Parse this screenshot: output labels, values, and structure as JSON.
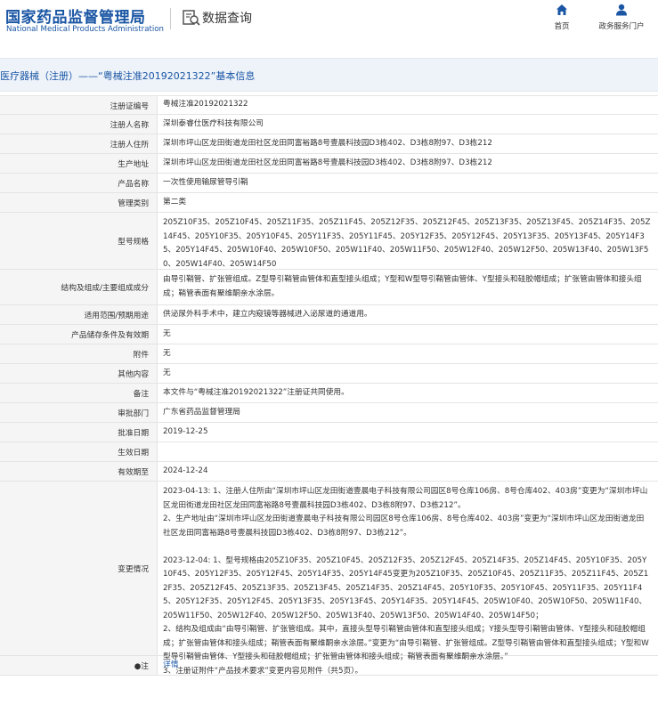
{
  "header": {
    "logo_cn": "国家药品监督管理局",
    "logo_en": "National Medical Products Administration",
    "query_title": "数据查询",
    "nav": [
      {
        "label": "首页",
        "icon": "home-icon"
      },
      {
        "label": "政务服务门户",
        "icon": "user-icon"
      }
    ]
  },
  "banner": {
    "title": "医疗器械（注册）——“粤械注准20192021322”基本信息"
  },
  "rows": [
    {
      "label": "注册证编号",
      "value": "粤械注准20192021322"
    },
    {
      "label": "注册人名称",
      "value": "深圳泰睿仕医疗科技有限公司"
    },
    {
      "label": "注册人住所",
      "value": "深圳市坪山区龙田街道龙田社区龙田同富裕路8号壹晨科技园D3栋402、D3栋8附97、D3栋212"
    },
    {
      "label": "生产地址",
      "value": "深圳市坪山区龙田街道龙田社区龙田同富裕路8号壹晨科技园D3栋402、D3栋8附97、D3栋212"
    },
    {
      "label": "产品名称",
      "value": "一次性使用输尿管导引鞘"
    },
    {
      "label": "管理类别",
      "value": "第二类"
    },
    {
      "label": "型号规格",
      "value": "205Z10F35、205Z10F45、205Z11F35、205Z11F45、205Z12F35、205Z12F45、205Z13F35、205Z13F45、205Z14F35、205Z14F45、205Y10F35、205Y10F45、205Y11F35、205Y11F45、205Y12F35、205Y12F45、205Y13F35、205Y13F45、205Y14F35、205Y14F45、205W10F40、205W10F50、205W11F40、205W11F50、205W12F40、205W12F50、205W13F40、205W13F50、205W14F40、205W14F50"
    },
    {
      "label": "结构及组成/主要组成成分",
      "value": "由导引鞘管、扩张管组成。Z型导引鞘管由管体和直型接头组成；Y型和W型导引鞘管由管体、Y型接头和硅胶帽组成；扩张管由管体和接头组成；鞘管表面有聚维酮亲水涂层。"
    },
    {
      "label": "适用范围/预期用途",
      "value": "供泌尿外科手术中，建立内窥镜等器械进入泌尿道的通道用。"
    },
    {
      "label": "产品储存条件及有效期",
      "value": "无"
    },
    {
      "label": "附件",
      "value": "无"
    },
    {
      "label": "其他内容",
      "value": "无"
    },
    {
      "label": "备注",
      "value": "本文件与“粤械注准20192021322”注册证共同使用。"
    },
    {
      "label": "审批部门",
      "value": "广东省药品监督管理局"
    },
    {
      "label": "批准日期",
      "value": "2019-12-25"
    },
    {
      "label": "生效日期",
      "value": ""
    },
    {
      "label": "有效期至",
      "value": "2024-12-24"
    },
    {
      "label": "变更情况",
      "value": "2023-04-13: 1、注册人住所由“深圳市坪山区龙田街道壹晨电子科技有限公司园区8号仓库106房、8号仓库402、403房”变更为“深圳市坪山区龙田街道龙田社区龙田同富裕路8号壹晨科技园D3栋402、D3栋8附97、D3栋212”。\n2、生产地址由“深圳市坪山区龙田街道壹晨电子科技有限公司园区8号仓库106房、8号仓库402、403房”变更为“深圳市坪山区龙田街道龙田社区龙田同富裕路8号壹晨科技园D3栋402、D3栋8附97、D3栋212”。\n\n2023-12-04: 1、型号规格由205Z10F35、205Z10F45、205Z12F35、205Z12F45、205Z14F35、205Z14F45、205Y10F35、205Y10F45、205Y12F35、205Y12F45、205Y14F35、205Y14F45变更为205Z10F35、205Z10F45、205Z11F35、205Z11F45、205Z12F35、205Z12F45、205Z13F35、205Z13F45、205Z14F35、205Z14F45、205Y10F35、205Y10F45、205Y11F35、205Y11F45、205Y12F35、205Y12F45、205Y13F35、205Y13F45、205Y14F35、205Y14F45、205W10F40、205W10F50、205W11F40、205W11F50、205W12F40、205W12F50、205W13F40、205W13F50、205W14F40、205W14F50；\n2、结构及组成由“由导引鞘管、扩张管组成。其中，直接头型导引鞘管由管体和直型接头组成；Y接头型导引鞘管由管体、Y型接头和硅胶帽组成；扩张管由管体和接头组成；鞘管表面有聚维酮亲水涂层。”变更为“由导引鞘管、扩张管组成。Z型导引鞘管由管体和直型接头组成；Y型和W型导引鞘管由管体、Y型接头和硅胶帽组成；扩张管由管体和接头组成；鞘管表面有聚维酮亲水涂层。”\n3、注册证附件“产品技术要求”变更内容见附件（共5页）。"
    },
    {
      "label": "●注",
      "value": "详情",
      "link": true
    }
  ]
}
